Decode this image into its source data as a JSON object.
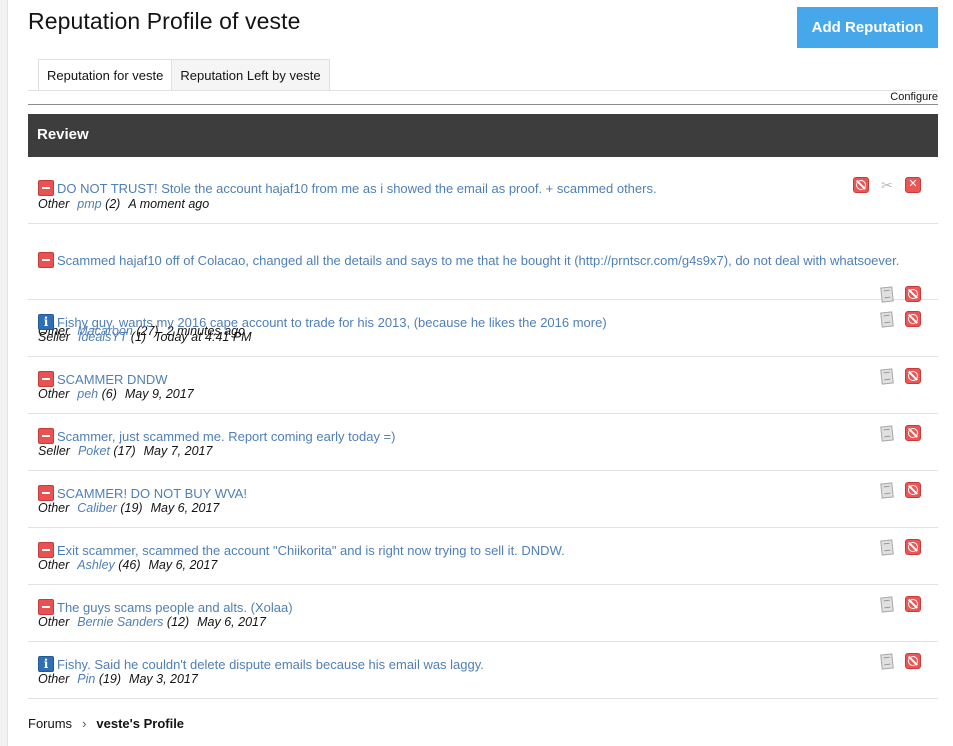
{
  "page": {
    "title": "Reputation Profile of veste",
    "add_button": "Add Reputation"
  },
  "tabs": [
    {
      "label": "Reputation for veste",
      "active": true
    },
    {
      "label": "Reputation Left by veste",
      "active": false
    }
  ],
  "configure_label": "Configure",
  "section_title": "Review",
  "entries": [
    {
      "kind": "negative",
      "message": "DO NOT TRUST! Stole the account hajaf10 from me as i showed the email as proof. + scammed others.",
      "type": "Other",
      "user": "pmp",
      "count": "(2)",
      "time": "A moment ago",
      "actions": [
        "ban-icon",
        "scissors-icon",
        "delete-icon"
      ]
    },
    {
      "kind": "negative",
      "message": "Scammed hajaf10 off of Colacao, changed all the details and says to me that he bought it (http://prntscr.com/g4s9x7), do not deal with whatsoever.",
      "type": "Other",
      "user": "Macaroon",
      "count": "(27)",
      "time": "2 minutes ago",
      "actions": [
        "note-icon",
        "ban-icon"
      ]
    },
    {
      "kind": "neutral",
      "message": "Fishy guy, wants my 2016 cape account to trade for his 2013, (because he likes the 2016 more)",
      "type": "Seller",
      "user": "IdealsYT",
      "count": "(1)",
      "time": "Today at 4:41 PM",
      "actions": [
        "note-icon",
        "ban-icon"
      ]
    },
    {
      "kind": "negative",
      "message": "SCAMMER DNDW",
      "type": "Other",
      "user": "peh",
      "count": "(6)",
      "time": "May 9, 2017",
      "actions": [
        "note-icon",
        "ban-icon"
      ]
    },
    {
      "kind": "negative",
      "message": "Scammer, just scammed me. Report coming early today =)",
      "type": "Seller",
      "user": "Poket",
      "count": "(17)",
      "time": "May 7, 2017",
      "actions": [
        "note-icon",
        "ban-icon"
      ]
    },
    {
      "kind": "negative",
      "message": "SCAMMER! DO NOT BUY WVA!",
      "type": "Other",
      "user": "Caliber",
      "count": "(19)",
      "time": "May 6, 2017",
      "actions": [
        "note-icon",
        "ban-icon"
      ]
    },
    {
      "kind": "negative",
      "message": "Exit scammer, scammed the account \"Chiikorita\" and is right now trying to sell it. DNDW.",
      "type": "Other",
      "user": "Ashley",
      "count": "(46)",
      "time": "May 6, 2017",
      "actions": [
        "note-icon",
        "ban-icon"
      ]
    },
    {
      "kind": "negative",
      "message": "The guys scams people and alts. (Xolaa)",
      "type": "Other",
      "user": "Bernie Sanders",
      "count": "(12)",
      "time": "May 6, 2017",
      "actions": [
        "note-icon",
        "ban-icon"
      ]
    },
    {
      "kind": "neutral",
      "message": "Fishy. Said he couldn't delete dispute emails because his email was laggy.",
      "type": "Other",
      "user": "Pin",
      "count": "(19)",
      "time": "May 3, 2017",
      "actions": [
        "note-icon",
        "ban-icon"
      ]
    }
  ],
  "breadcrumb": {
    "items": [
      "Forums"
    ],
    "separator": "›",
    "current": "veste's Profile"
  }
}
